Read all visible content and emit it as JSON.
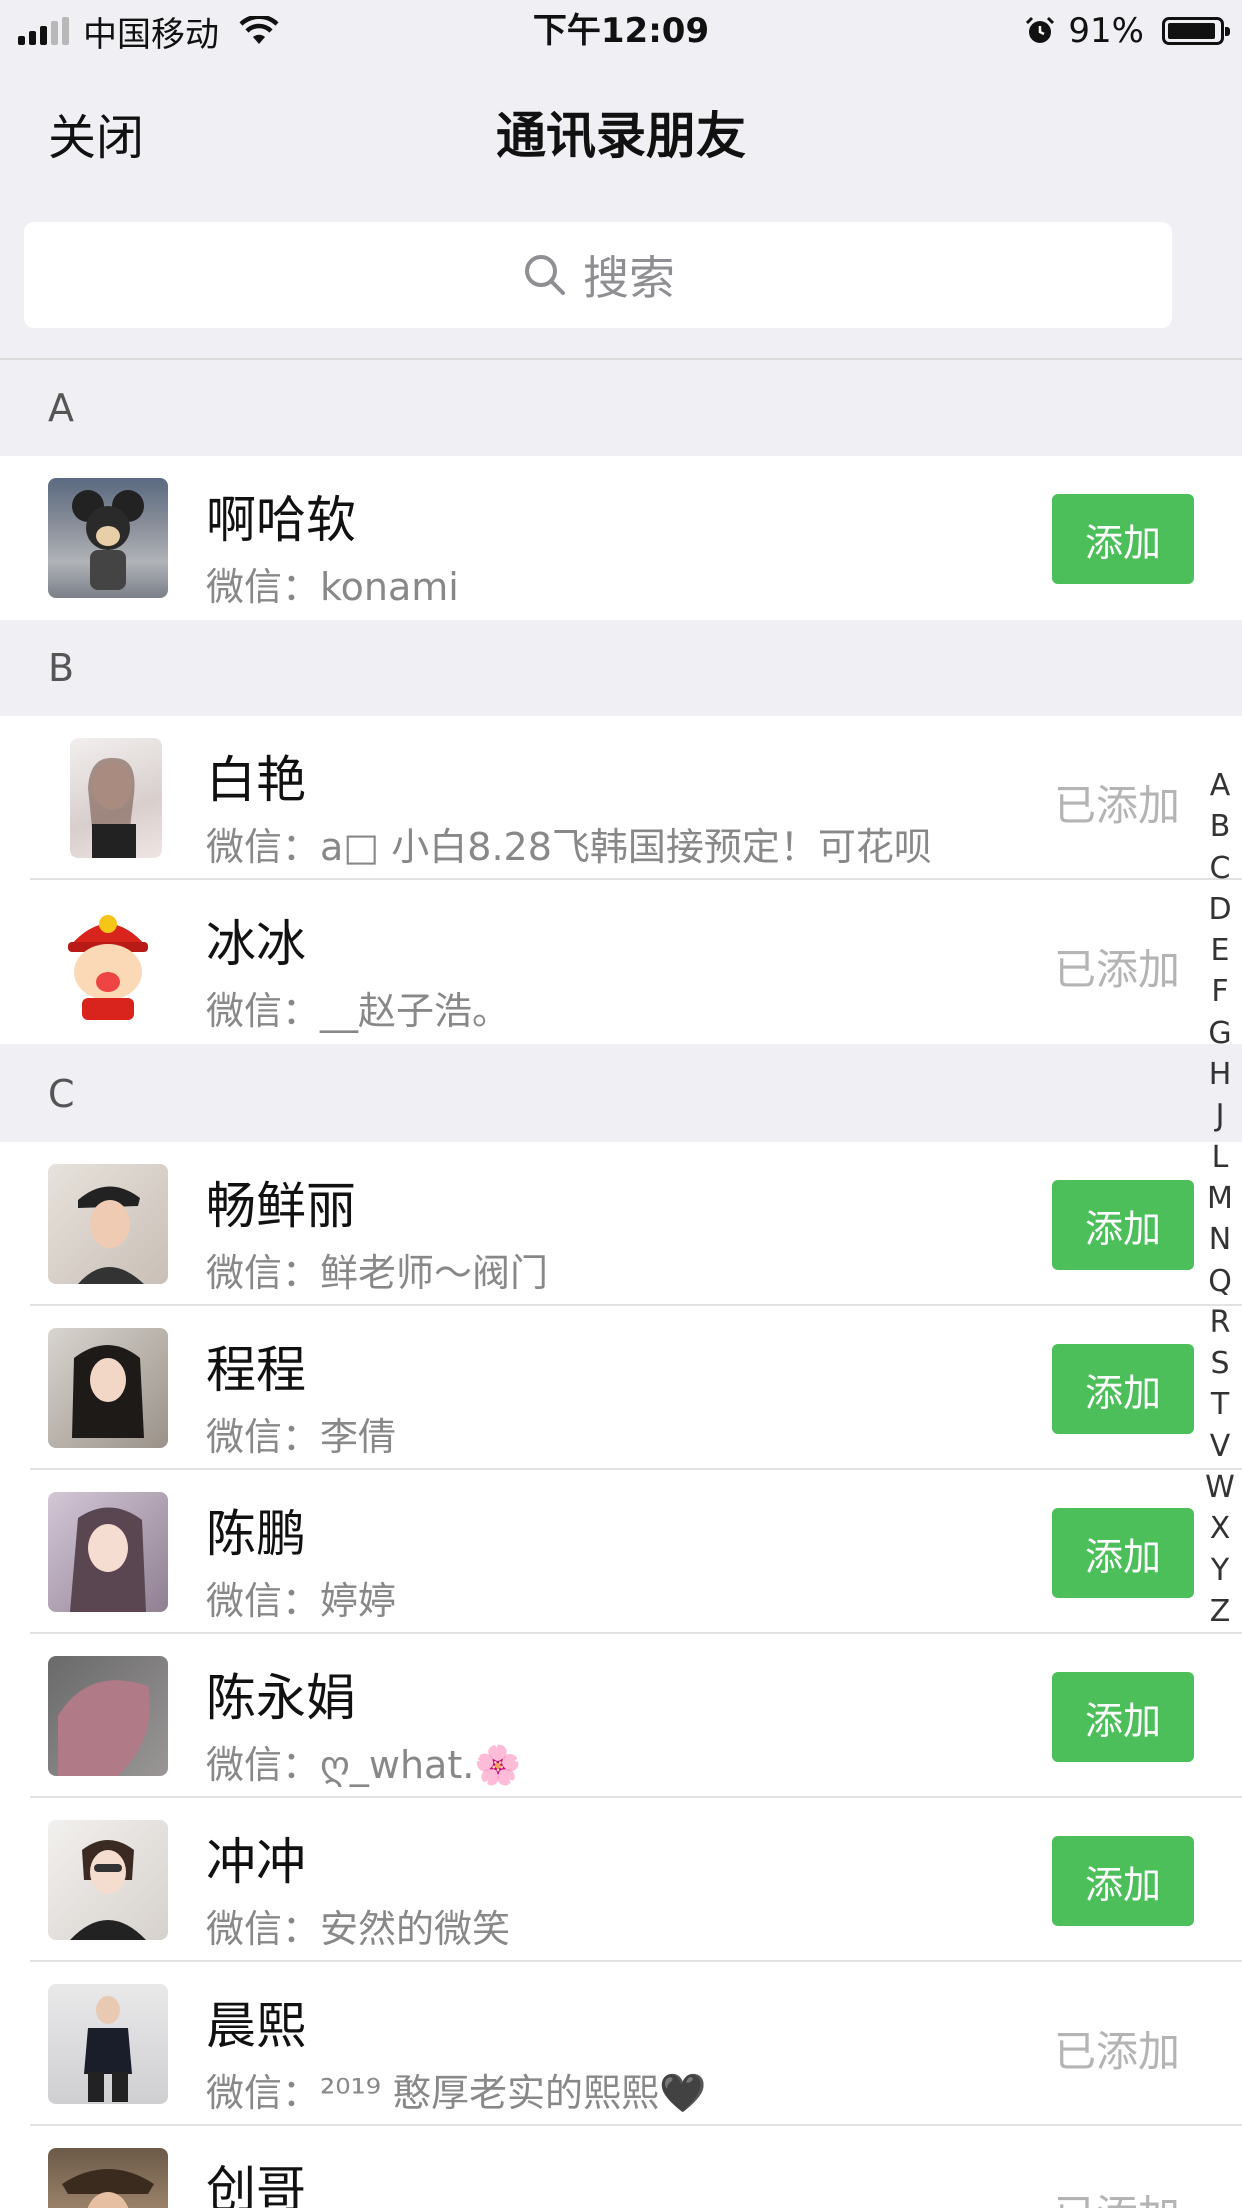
{
  "status_bar": {
    "carrier": "中国移动",
    "time": "下午12:09",
    "battery_percent": "91%"
  },
  "nav": {
    "close_label": "关闭",
    "title": "通讯录朋友"
  },
  "search": {
    "placeholder": "搜索"
  },
  "sections": [
    {
      "letter": "A",
      "contacts": [
        {
          "name": "啊哈软",
          "wechat_label": "微信：",
          "wechat": "konami",
          "action": "添加"
        }
      ]
    },
    {
      "letter": "B",
      "contacts": [
        {
          "name": "白艳",
          "wechat_label": "微信：",
          "wechat": "a□ 小白8.28飞韩国接预定！可花呗",
          "action": "已添加"
        },
        {
          "name": "冰冰",
          "wechat_label": "微信：",
          "wechat": "__赵子浩。",
          "action": "已添加"
        }
      ]
    },
    {
      "letter": "C",
      "contacts": [
        {
          "name": "畅鲜丽",
          "wechat_label": "微信：",
          "wechat": "鲜老师～阀门",
          "action": "添加"
        },
        {
          "name": "程程",
          "wechat_label": "微信：",
          "wechat": "李倩",
          "action": "添加"
        },
        {
          "name": "陈鹏",
          "wechat_label": "微信：",
          "wechat": "婷婷",
          "action": "添加"
        },
        {
          "name": "陈永娟",
          "wechat_label": "微信：",
          "wechat": "ღ_what.🌸",
          "action": "添加"
        },
        {
          "name": "冲冲",
          "wechat_label": "微信：",
          "wechat": "安然的微笑",
          "action": "添加"
        },
        {
          "name": "晨熙",
          "wechat_label": "微信：",
          "wechat": "²⁰¹⁹ 憨厚老实的熙熙🖤",
          "action": "已添加"
        },
        {
          "name": "创哥",
          "wechat_label": "",
          "wechat": "",
          "action": "已添加"
        }
      ]
    }
  ],
  "index_letters": [
    "A",
    "B",
    "C",
    "D",
    "E",
    "F",
    "G",
    "H",
    "J",
    "L",
    "M",
    "N",
    "Q",
    "R",
    "S",
    "T",
    "V",
    "W",
    "X",
    "Y",
    "Z"
  ]
}
